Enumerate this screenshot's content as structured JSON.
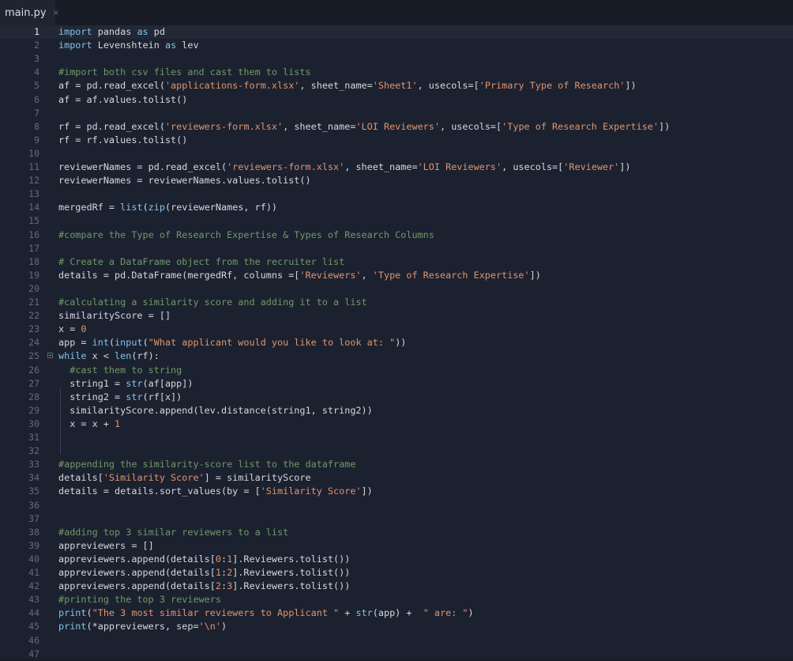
{
  "tab": {
    "filename": "main.py",
    "close_glyph": "×"
  },
  "colors": {
    "keyword": "#7ec4e8",
    "string": "#e0956b",
    "comment": "#6f9a68",
    "text": "#d4d8de",
    "background": "#1c2130"
  },
  "active_line": 1,
  "lines": [
    {
      "n": "1",
      "tokens": [
        [
          "kw",
          "import"
        ],
        [
          "t",
          " pandas "
        ],
        [
          "kw",
          "as"
        ],
        [
          "t",
          " pd"
        ]
      ]
    },
    {
      "n": "2",
      "tokens": [
        [
          "kw",
          "import"
        ],
        [
          "t",
          " Levenshtein "
        ],
        [
          "kw",
          "as"
        ],
        [
          "t",
          " lev"
        ]
      ]
    },
    {
      "n": "3",
      "tokens": []
    },
    {
      "n": "4",
      "tokens": [
        [
          "com",
          "#import both csv files and cast them to lists"
        ]
      ]
    },
    {
      "n": "5",
      "tokens": [
        [
          "t",
          "af = pd.read_excel("
        ],
        [
          "str",
          "'applications-form.xlsx'"
        ],
        [
          "t",
          ", sheet_name="
        ],
        [
          "str",
          "'Sheet1'"
        ],
        [
          "t",
          ", usecols=["
        ],
        [
          "str",
          "'Primary Type of Research'"
        ],
        [
          "t",
          "])"
        ]
      ]
    },
    {
      "n": "6",
      "tokens": [
        [
          "t",
          "af = af.values.tolist()"
        ]
      ]
    },
    {
      "n": "7",
      "tokens": []
    },
    {
      "n": "8",
      "tokens": [
        [
          "t",
          "rf = pd.read_excel("
        ],
        [
          "str",
          "'reviewers-form.xlsx'"
        ],
        [
          "t",
          ", sheet_name="
        ],
        [
          "str",
          "'LOI Reviewers'"
        ],
        [
          "t",
          ", usecols=["
        ],
        [
          "str",
          "'Type of Research Expertise'"
        ],
        [
          "t",
          "])"
        ]
      ]
    },
    {
      "n": "9",
      "tokens": [
        [
          "t",
          "rf = rf.values.tolist()"
        ]
      ]
    },
    {
      "n": "10",
      "tokens": []
    },
    {
      "n": "11",
      "tokens": [
        [
          "t",
          "reviewerNames = pd.read_excel("
        ],
        [
          "str",
          "'reviewers-form.xlsx'"
        ],
        [
          "t",
          ", sheet_name="
        ],
        [
          "str",
          "'LOI Reviewers'"
        ],
        [
          "t",
          ", usecols=["
        ],
        [
          "str",
          "'Reviewer'"
        ],
        [
          "t",
          "])"
        ]
      ]
    },
    {
      "n": "12",
      "tokens": [
        [
          "t",
          "reviewerNames = reviewerNames.values.tolist()"
        ]
      ]
    },
    {
      "n": "13",
      "tokens": []
    },
    {
      "n": "14",
      "tokens": [
        [
          "t",
          "mergedRf = "
        ],
        [
          "kw",
          "list"
        ],
        [
          "t",
          "("
        ],
        [
          "kw",
          "zip"
        ],
        [
          "t",
          "(reviewerNames, rf))"
        ]
      ]
    },
    {
      "n": "15",
      "tokens": []
    },
    {
      "n": "16",
      "tokens": [
        [
          "com",
          "#compare the Type of Research Expertise & Types of Research Columns"
        ]
      ]
    },
    {
      "n": "17",
      "tokens": []
    },
    {
      "n": "18",
      "tokens": [
        [
          "com",
          "# Create a DataFrame object from the recruiter list"
        ]
      ]
    },
    {
      "n": "19",
      "tokens": [
        [
          "t",
          "details = pd.DataFrame(mergedRf, columns =["
        ],
        [
          "str",
          "'Reviewers'"
        ],
        [
          "t",
          ", "
        ],
        [
          "str",
          "'Type of Research Expertise'"
        ],
        [
          "t",
          "])"
        ]
      ]
    },
    {
      "n": "20",
      "tokens": []
    },
    {
      "n": "21",
      "tokens": [
        [
          "com",
          "#calculating a similarity score and adding it to a list"
        ]
      ]
    },
    {
      "n": "22",
      "tokens": [
        [
          "t",
          "similarityScore = []"
        ]
      ]
    },
    {
      "n": "23",
      "tokens": [
        [
          "t",
          "x = "
        ],
        [
          "num",
          "0"
        ]
      ]
    },
    {
      "n": "24",
      "tokens": [
        [
          "t",
          "app = "
        ],
        [
          "kw",
          "int"
        ],
        [
          "t",
          "("
        ],
        [
          "kw",
          "input"
        ],
        [
          "t",
          "("
        ],
        [
          "str",
          "\"What applicant would you like to look at: \""
        ],
        [
          "t",
          "))"
        ]
      ]
    },
    {
      "n": "25",
      "tokens": [
        [
          "kw",
          "while"
        ],
        [
          "t",
          " x < "
        ],
        [
          "kw",
          "len"
        ],
        [
          "t",
          "(rf):"
        ]
      ],
      "fold": true
    },
    {
      "n": "26",
      "tokens": [
        [
          "t",
          "  "
        ],
        [
          "com",
          "#cast them to string"
        ]
      ]
    },
    {
      "n": "27",
      "tokens": [
        [
          "t",
          "  string1 = "
        ],
        [
          "kw",
          "str"
        ],
        [
          "t",
          "(af[app])"
        ]
      ]
    },
    {
      "n": "28",
      "tokens": [
        [
          "t",
          "  string2 = "
        ],
        [
          "kw",
          "str"
        ],
        [
          "t",
          "(rf[x])"
        ]
      ]
    },
    {
      "n": "29",
      "tokens": [
        [
          "t",
          "  similarityScore.append(lev.distance(string1, string2))"
        ]
      ]
    },
    {
      "n": "30",
      "tokens": [
        [
          "t",
          "  x = x + "
        ],
        [
          "num",
          "1"
        ]
      ]
    },
    {
      "n": "31",
      "tokens": []
    },
    {
      "n": "32",
      "tokens": []
    },
    {
      "n": "33",
      "tokens": [
        [
          "com",
          "#appending the similarity-score list to the dataframe"
        ]
      ]
    },
    {
      "n": "34",
      "tokens": [
        [
          "t",
          "details["
        ],
        [
          "str",
          "'Similarity Score'"
        ],
        [
          "t",
          "] = similarityScore"
        ]
      ]
    },
    {
      "n": "35",
      "tokens": [
        [
          "t",
          "details = details.sort_values(by = ["
        ],
        [
          "str",
          "'Similarity Score'"
        ],
        [
          "t",
          "])"
        ]
      ]
    },
    {
      "n": "36",
      "tokens": []
    },
    {
      "n": "37",
      "tokens": []
    },
    {
      "n": "38",
      "tokens": [
        [
          "com",
          "#adding top 3 similar reviewers to a list"
        ]
      ]
    },
    {
      "n": "39",
      "tokens": [
        [
          "t",
          "appreviewers = []"
        ]
      ]
    },
    {
      "n": "40",
      "tokens": [
        [
          "t",
          "appreviewers.append(details["
        ],
        [
          "num",
          "0"
        ],
        [
          "t",
          ":"
        ],
        [
          "num",
          "1"
        ],
        [
          "t",
          "].Reviewers.tolist())"
        ]
      ]
    },
    {
      "n": "41",
      "tokens": [
        [
          "t",
          "appreviewers.append(details["
        ],
        [
          "num",
          "1"
        ],
        [
          "t",
          ":"
        ],
        [
          "num",
          "2"
        ],
        [
          "t",
          "].Reviewers.tolist())"
        ]
      ]
    },
    {
      "n": "42",
      "tokens": [
        [
          "t",
          "appreviewers.append(details["
        ],
        [
          "num",
          "2"
        ],
        [
          "t",
          ":"
        ],
        [
          "num",
          "3"
        ],
        [
          "t",
          "].Reviewers.tolist())"
        ]
      ]
    },
    {
      "n": "43",
      "tokens": [
        [
          "com",
          "#printing the top 3 reviewers"
        ]
      ]
    },
    {
      "n": "44",
      "tokens": [
        [
          "kw",
          "print"
        ],
        [
          "t",
          "("
        ],
        [
          "str",
          "\"The 3 most similar reviewers to Applicant \""
        ],
        [
          "t",
          " + "
        ],
        [
          "kw",
          "str"
        ],
        [
          "t",
          "(app) +  "
        ],
        [
          "str",
          "\" are: \""
        ],
        [
          "t",
          ")"
        ]
      ]
    },
    {
      "n": "45",
      "tokens": [
        [
          "kw",
          "print"
        ],
        [
          "t",
          "(*appreviewers, sep="
        ],
        [
          "str",
          "'\\n'"
        ],
        [
          "t",
          ")"
        ]
      ]
    },
    {
      "n": "46",
      "tokens": []
    },
    {
      "n": "47",
      "tokens": []
    }
  ]
}
